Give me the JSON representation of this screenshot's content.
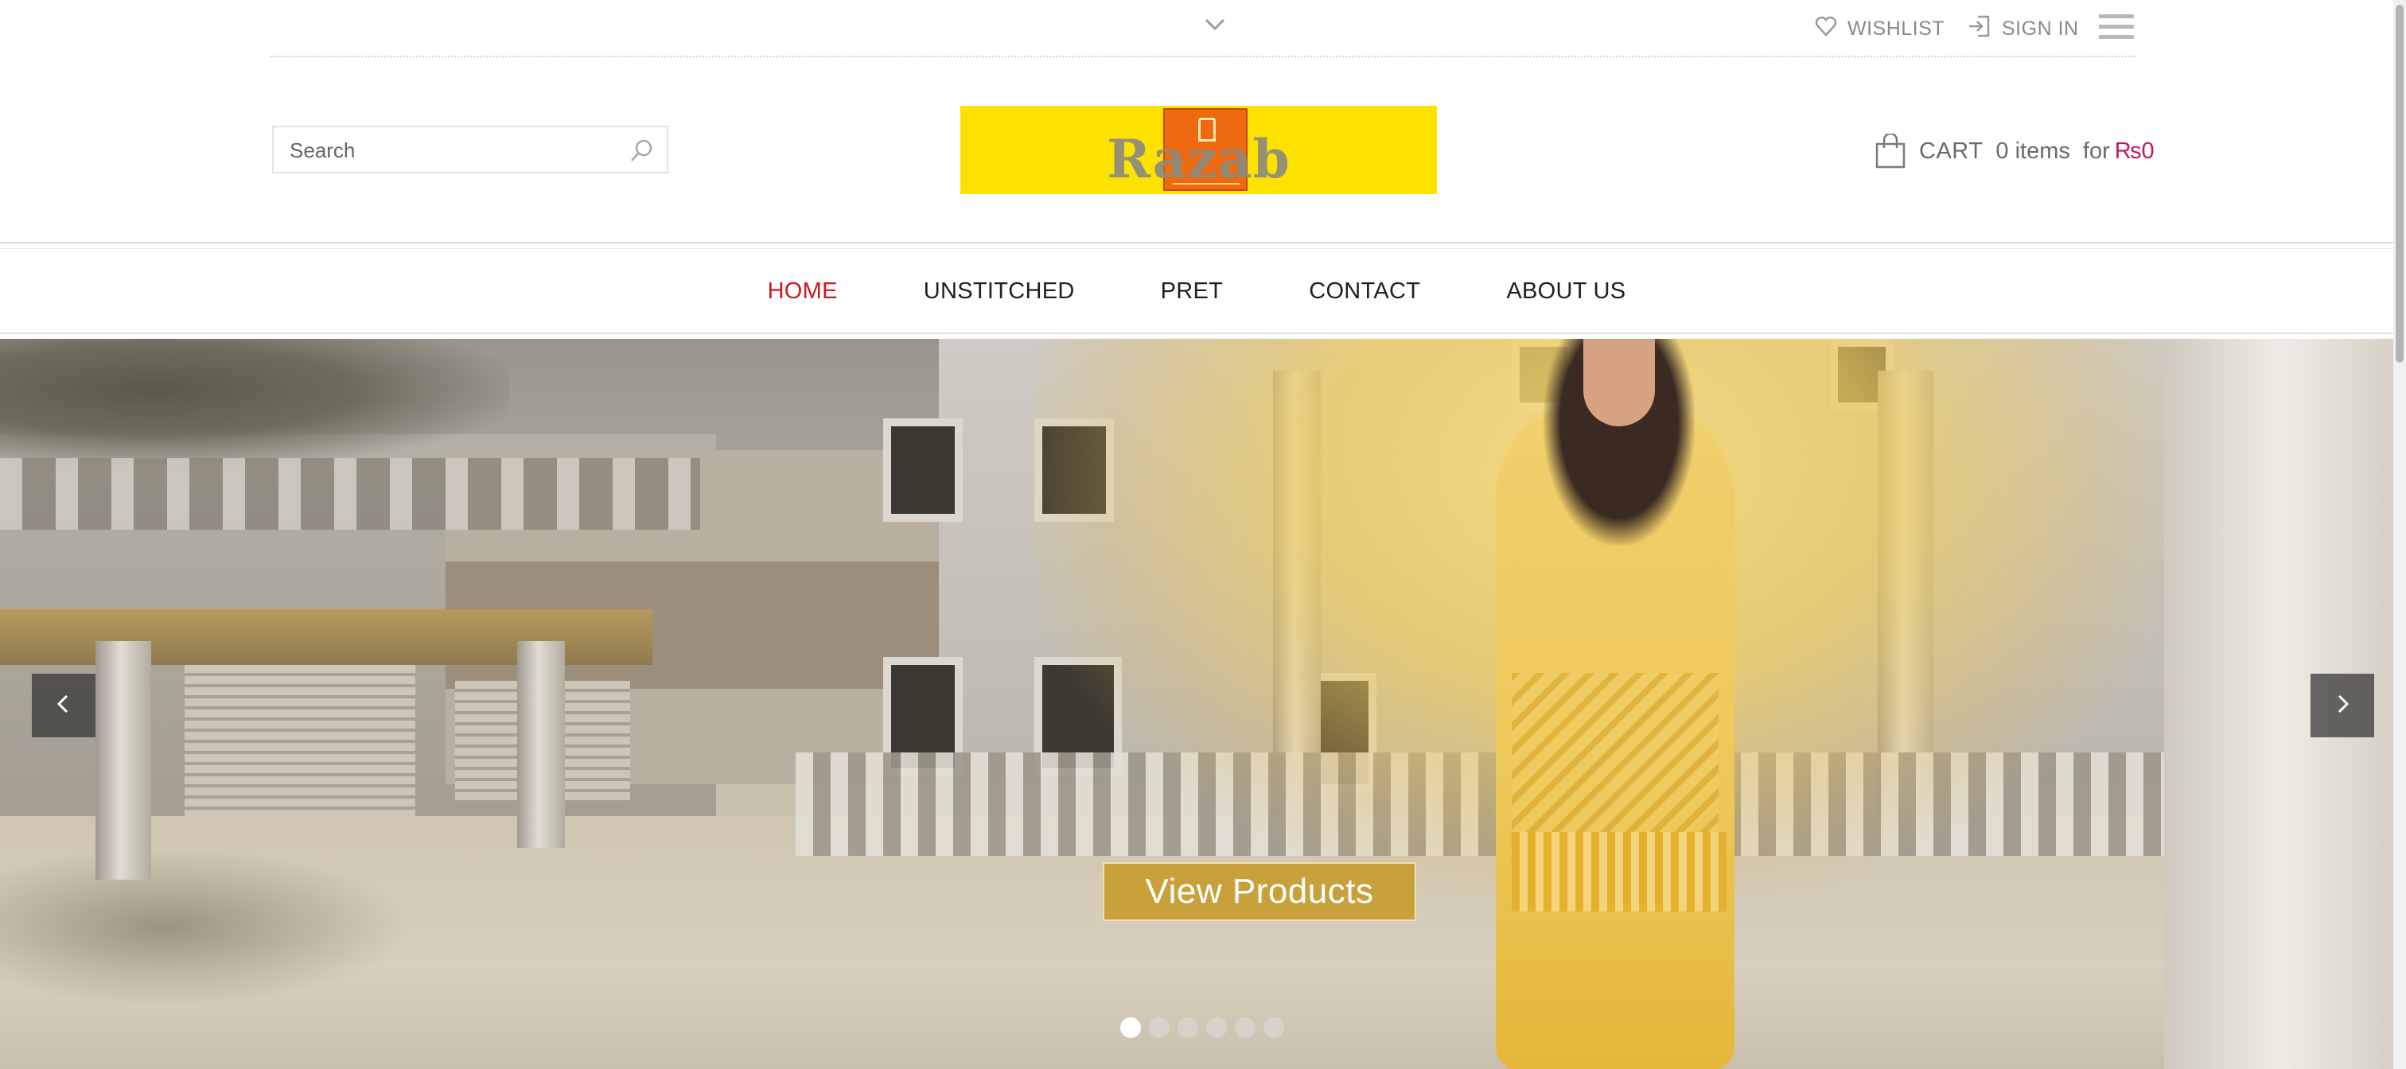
{
  "topbar": {
    "wishlist_label": "WISHLIST",
    "signin_label": "SIGN IN",
    "icons": {
      "toggle": "chevron-down-icon",
      "wishlist": "heart-icon",
      "signin": "sign-in-icon",
      "menu": "hamburger-icon"
    }
  },
  "header": {
    "search": {
      "placeholder": "Search",
      "value": ""
    },
    "logo": {
      "text": "Razab",
      "background": "#fde200",
      "emblem_color": "#ee6a10"
    },
    "cart": {
      "label": "CART",
      "items": "0 items",
      "for": "for",
      "price": "₨0",
      "price_color": "#c2185b"
    }
  },
  "nav": {
    "items": [
      {
        "label": "HOME",
        "active": true
      },
      {
        "label": "UNSTITCHED",
        "active": false
      },
      {
        "label": "PRET",
        "active": false
      },
      {
        "label": "CONTACT",
        "active": false
      },
      {
        "label": "ABOUT US",
        "active": false
      }
    ],
    "active_color": "#c8191f"
  },
  "hero": {
    "cta_label": "View Products",
    "cta_color": "#c9a13c",
    "slide_count": 6,
    "active_slide": 1,
    "icons": {
      "prev": "chevron-left-icon",
      "next": "chevron-right-icon"
    }
  }
}
